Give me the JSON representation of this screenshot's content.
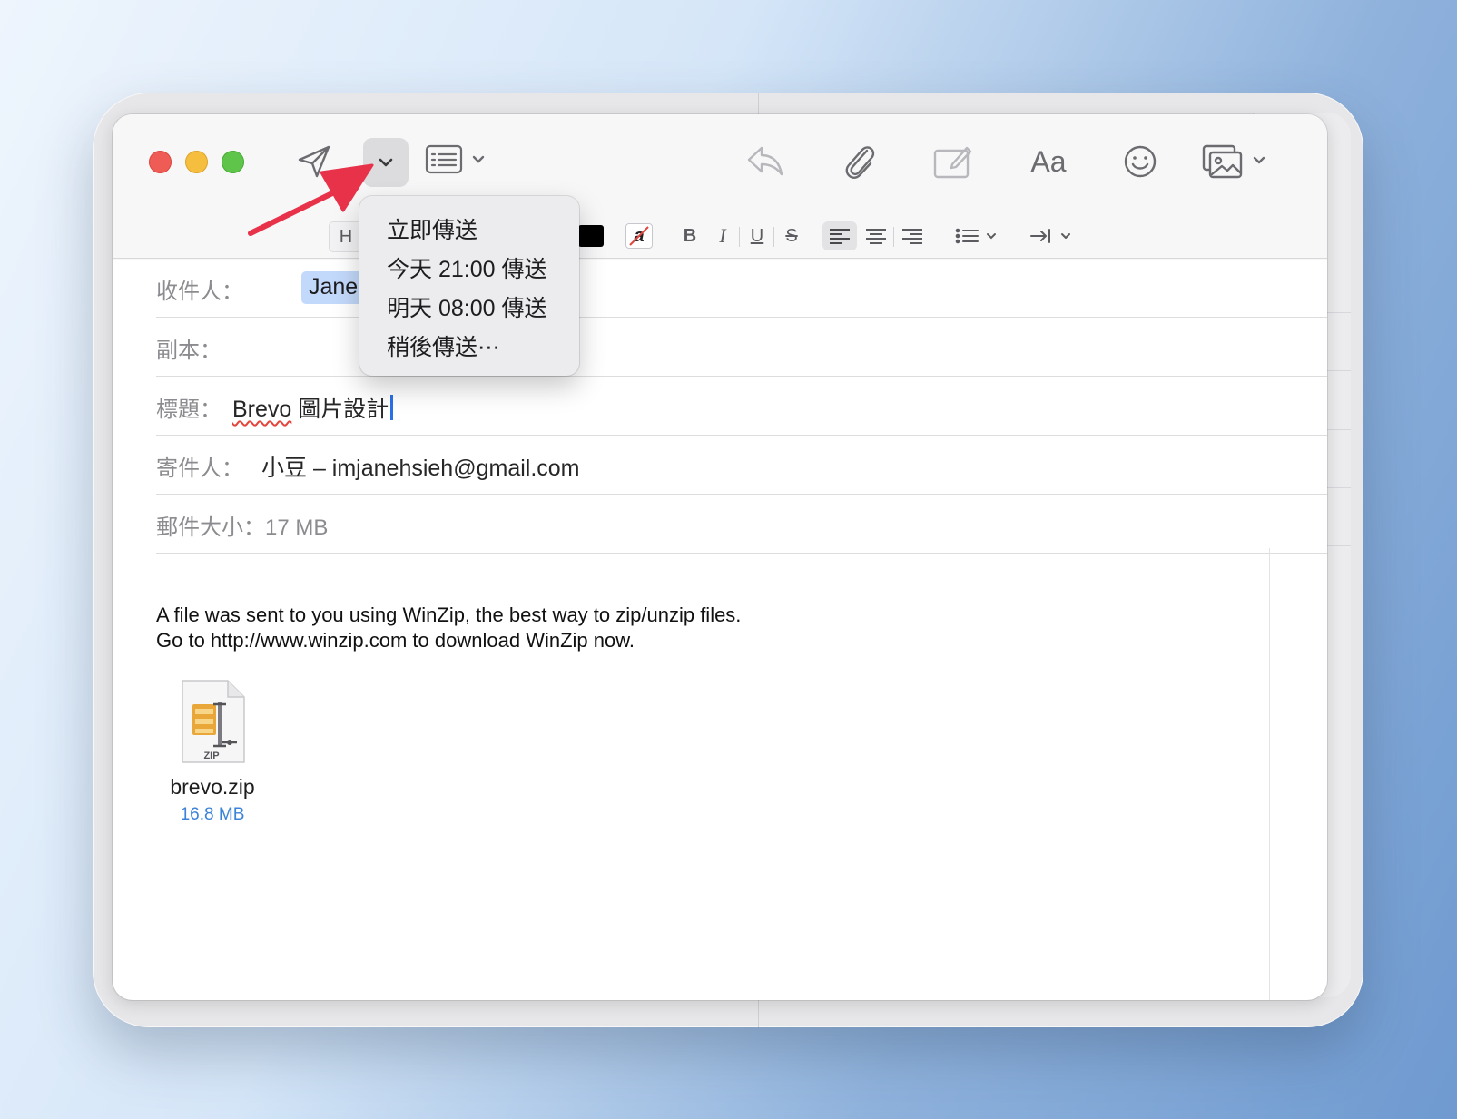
{
  "toolbar": {
    "format_font_label": "H",
    "format_text_color_glyph": "a",
    "format_bold": "B",
    "format_italic": "I",
    "format_underline": "U",
    "format_strike": "S",
    "font_button_label": "Aa"
  },
  "send_menu": {
    "items": [
      {
        "label": "立即傳送"
      },
      {
        "label": "今天 21:00 傳送"
      },
      {
        "label": "明天 08:00 傳送"
      },
      {
        "label": "稍後傳送⋯"
      }
    ]
  },
  "fields": {
    "to_label": "收件人：",
    "to_value": "Jane Hsieh",
    "cc_label": "副本：",
    "subject_label": "標題：",
    "subject_brand": "Brevo",
    "subject_rest": " 圖片設計",
    "from_label": "寄件人：",
    "from_value": "小豆 – imjanehsieh@gmail.com",
    "size_label": "郵件大小：",
    "size_value": "17 MB"
  },
  "body": {
    "line1": "A file was sent to you using WinZip, the best way to zip/unzip files.",
    "line2": "Go to http://www.winzip.com to download WinZip now."
  },
  "attachment": {
    "icon_label": "ZIP",
    "name": "brevo.zip",
    "size": "16.8 MB"
  },
  "colors": {
    "accent": "#2a70e6",
    "annotation_arrow": "#e8324a",
    "recipient_highlight": "#c3d9fb",
    "attachment_size": "#3b82d9"
  }
}
